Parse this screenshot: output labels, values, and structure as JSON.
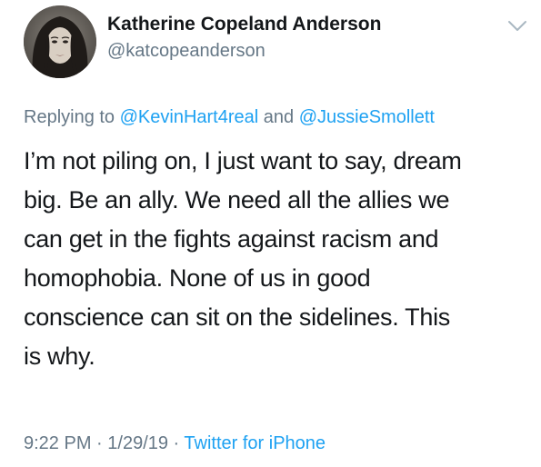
{
  "author": {
    "name": "Katherine Copeland Anderson",
    "handle": "@katcopeanderson"
  },
  "reply": {
    "prefix": "Replying to ",
    "mentions": [
      "@KevinHart4real",
      "@JussieSmollett"
    ],
    "conjunction": " and "
  },
  "tweet": {
    "lines": [
      "I’m not piling on, I just want to say, dream",
      "big. Be an ally. We need all the allies we",
      "can get in the fights against racism and",
      "homophobia. None of us in good",
      "conscience can sit on the sidelines. This",
      "is why."
    ]
  },
  "meta": {
    "time": "9:22 PM",
    "separator": " · ",
    "date": "1/29/19",
    "source": "Twitter for iPhone"
  },
  "icons": {
    "menu": "chevron-down-icon",
    "avatar": "profile-photo"
  },
  "colors": {
    "text": "#14171a",
    "secondary": "#657786",
    "link": "#1da1f2"
  }
}
